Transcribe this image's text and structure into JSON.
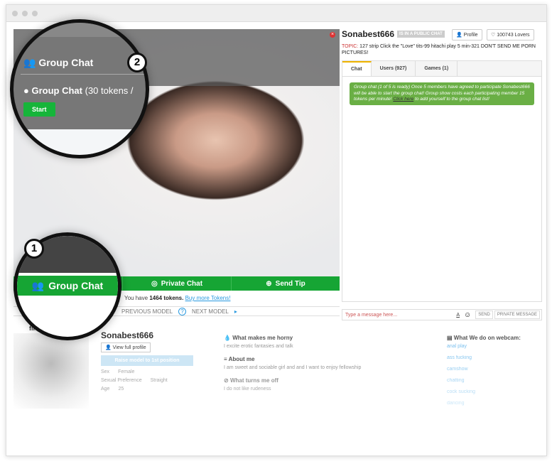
{
  "overlay": {
    "title": "Group Chat",
    "option": "Group Chat",
    "option_price": "(30 tokens /",
    "start": "Start",
    "callout_1": "1",
    "callout_2": "2"
  },
  "buttons": {
    "group": "Group Chat",
    "private": "Private Chat",
    "tip": "Send Tip"
  },
  "tokens": {
    "prefix": "You have",
    "count": "1464 tokens.",
    "buy": "Buy more Tokens!"
  },
  "nav": {
    "prev": "PREVIOUS MODEL",
    "help": "?",
    "next": "NEXT MODEL"
  },
  "model": {
    "name": "Sonabest666",
    "status": "IS IN A PUBLIC CHAT",
    "profile": "Profile",
    "lovers": "100743 Lovers",
    "topic_label": "TOPIC:",
    "topic": "127 strip Click the \"Love\" tits-99 hitachi play 5 min-321 DON'T SEND ME PORN PICTURES!"
  },
  "tabs": [
    {
      "label": "Chat"
    },
    {
      "label": "Users (927)"
    },
    {
      "label": "Games (1)"
    }
  ],
  "chat_msg": {
    "text": "Group chat (1 of 5 is ready) Once 5 members have agreed to participate Sonabest666 will be able to start the group chat! Group show costs each participating member 15 tokens per minute!",
    "link": "Click here",
    "rest": "to add yourself to the group chat list!"
  },
  "chat_input": {
    "placeholder": "Type a message here...",
    "font": "A",
    "send": "SEND",
    "private": "PRIVATE MESSAGE"
  },
  "profile": {
    "tab": "file",
    "name": "Sonabest666",
    "view": "View full profile",
    "raise": "Raise model to 1st position",
    "fields": [
      {
        "k": "Sex",
        "v": "Female"
      },
      {
        "k": "Sexual Preference",
        "v": "Straight"
      },
      {
        "k": "Age",
        "v": "25"
      }
    ],
    "horny_h": "What makes me horny",
    "horny": "I excite erotic fantasies and talk",
    "about_h": "About me",
    "about": "I am sweet and sociable girl and and I want to enjoy fellowship",
    "off_h": "What turns me off",
    "off": "I do not like rudeness",
    "webcam_h": "What We do on webcam:",
    "webcam": [
      "anal play",
      "ass fucking",
      "camshow",
      "chatting",
      "cock sucking",
      "dancing"
    ]
  },
  "colors": {
    "green": "#16a534",
    "blue": "#2a9ae0",
    "chat_green": "#6aaf45"
  }
}
